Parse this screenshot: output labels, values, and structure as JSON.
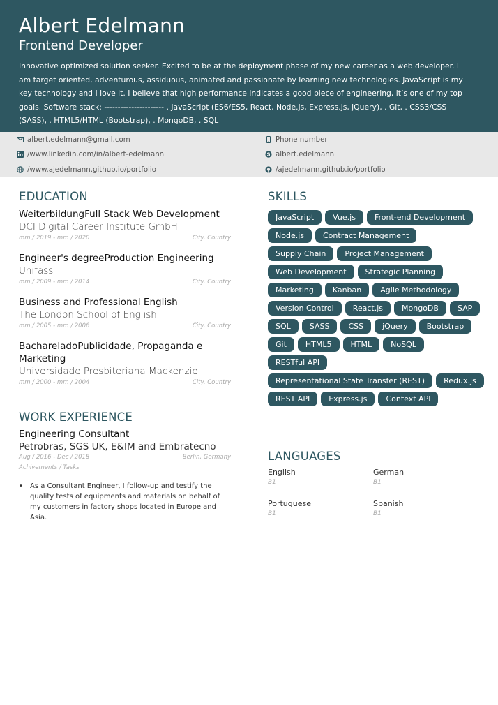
{
  "header": {
    "name": "Albert Edelmann",
    "role": "Frontend Developer",
    "summary": "Innovative optimized solution seeker. Excited to be at the deployment phase of my new career as a web developer. I am target oriented, adventurous, assiduous, animated and passionate by learning new technologies. JavaScript is my key technology and I love it. I believe that high performance indicates a good piece of engineering, it’s one of my top goals. Software stack: ---------------------- . JavaScript (ES6/ES5, React, Node.js, Express.js, jQuery), . Git, . CSS3/CSS (SASS), . HTML5/HTML (Bootstrap), . MongoDB, . SQL"
  },
  "contact": {
    "email": "albert.edelmann@gmail.com",
    "phone": "Phone number",
    "linkedin": "/www.linkedin.com/in/albert-edelmann",
    "skype": "albert.edelmann",
    "website": "/www.ajedelmann.github.io/portfolio",
    "github": "/ajedelmann.github.io/portfolio"
  },
  "education": {
    "heading": "EDUCATION",
    "items": [
      {
        "title": "WeiterbildungFull Stack Web Development",
        "institution": "DCI Digital Career Institute GmbH",
        "dates": "mm / 2019 - mm / 2020",
        "location": "City, Country"
      },
      {
        "title": "Engineer's degreeProduction Engineering",
        "institution": "Unifass",
        "dates": "mm / 2009 - mm / 2014",
        "location": "City, Country"
      },
      {
        "title": "Business and Professional English",
        "institution": "The London School of English",
        "dates": "mm / 2005 - mm / 2006",
        "location": "City, Country"
      },
      {
        "title": "BachareladoPublicidade, Propaganda e Marketing",
        "institution": "Universidade Presbiteriana Mackenzie",
        "dates": "mm / 2000 - mm / 2004",
        "location": "City, Country"
      }
    ]
  },
  "work": {
    "heading": "WORK EXPERIENCE",
    "title": "Engineering Consultant",
    "company": "Petrobras, SGS UK, E&IM and Embratecno",
    "dates": "Aug / 2016 - Dec / 2018",
    "location": "Berlin, Germany",
    "subtitle": "Achivements / Tasks",
    "bullet": "As a Consultant Engineer, I follow-up and testify the quality tests of equipments and materials on behalf of my customers in factory shops located in Europe and Asia."
  },
  "skills": {
    "heading": "SKILLS",
    "items": [
      "JavaScript",
      "Vue.js",
      "Front-end Development",
      "Node.js",
      "Contract Management",
      "Supply Chain",
      "Project Management",
      "Web Development",
      "Strategic Planning",
      "Marketing",
      "Kanban",
      "Agile Methodology",
      "Version Control",
      "React.js",
      "MongoDB",
      "SAP",
      "SQL",
      "SASS",
      "CSS",
      "jQuery",
      "Bootstrap",
      "Git",
      "HTML5",
      "HTML",
      "NoSQL",
      "RESTful API",
      "Representational State Transfer (REST)",
      "Redux.js",
      "REST API",
      "Express.js",
      "Context API"
    ]
  },
  "languages": {
    "heading": "LANGUAGES",
    "items": [
      {
        "name": "English",
        "level": "B1"
      },
      {
        "name": "German",
        "level": "B1"
      },
      {
        "name": "Portuguese",
        "level": "B1"
      },
      {
        "name": "Spanish",
        "level": "B1"
      }
    ]
  },
  "colors": {
    "accent": "#2e5761",
    "contact_bg": "#e8e8e8"
  }
}
